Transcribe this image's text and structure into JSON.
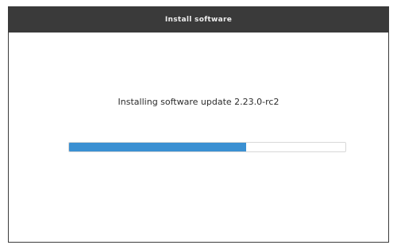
{
  "dialog": {
    "title": "Install software",
    "message": "Installing software update 2.23.0-rc2"
  },
  "progress": {
    "value": 0.64
  },
  "colors": {
    "titlebar": "#3a3a3a",
    "title_text": "#eeeeee",
    "progress_fill": "#3a90d2",
    "progress_track": "#ffffff",
    "progress_border": "#d8d8d8"
  }
}
